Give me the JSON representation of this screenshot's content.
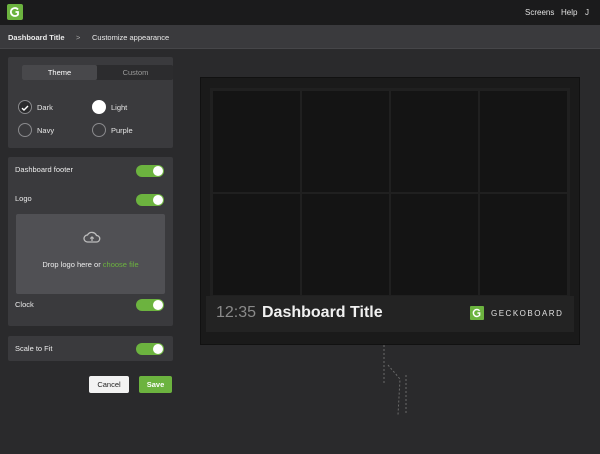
{
  "topbar": {
    "logo_icon": "geckoboard-logo-icon",
    "nav": [
      "Screens",
      "Help",
      "J"
    ]
  },
  "breadcrumb": {
    "title": "Dashboard Title",
    "separator": ">",
    "current": "Customize appearance"
  },
  "theme_panel": {
    "tabs": [
      "Theme",
      "Custom"
    ],
    "active_tab": "Theme",
    "swatches": [
      {
        "label": "Dark",
        "color": "#2a2a2c",
        "selected": true
      },
      {
        "label": "Light",
        "color": "#ffffff",
        "selected": false
      },
      {
        "label": "Navy",
        "color": "#2a2a2c",
        "selected": false
      },
      {
        "label": "Purple",
        "color": "#2a2a2c",
        "selected": false
      }
    ]
  },
  "options": {
    "footer_label": "Dashboard footer",
    "footer_on": true,
    "logo_label": "Logo",
    "logo_on": true,
    "drop_text": "Drop logo here or ",
    "drop_link": "choose file",
    "clock_label": "Clock",
    "clock_on": true,
    "scale_label": "Scale to Fit",
    "scale_on": true
  },
  "actions": {
    "cancel": "Cancel",
    "save": "Save"
  },
  "preview": {
    "clock": "12:35",
    "title": "Dashboard Title",
    "brand": "GECKOBOARD"
  },
  "colors": {
    "accent": "#6cb33f",
    "background": "#2a2a2c",
    "panel": "#3a3a3d"
  }
}
